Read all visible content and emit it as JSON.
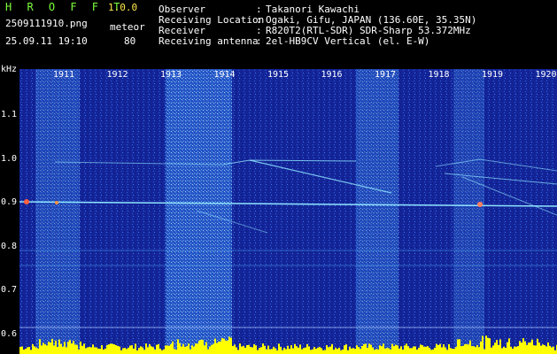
{
  "app": {
    "title": "H R O F F T",
    "version": "1.0.0",
    "filename": "2509111910.png",
    "meteor_label": "meteor",
    "datetime": "25.09.11 19:10",
    "meteor_count": "80"
  },
  "info": {
    "observer_label": "Observer",
    "observer_value": "Takanori Kawachi",
    "location_label": "Receiving Location",
    "location_value": "Ogaki, Gifu, JAPAN (136.60E, 35.35N)",
    "receiver_label": "Receiver",
    "receiver_value": "R820T2(RTL-SDR) SDR-Sharp 53.372MHz",
    "antenna_label": "Receiving antenna",
    "antenna_value": "2el-HB9CV Vertical (el. E-W)",
    "sep": ":"
  },
  "axes": {
    "unit": "kHz",
    "x_ticks": [
      "1911",
      "1912",
      "1913",
      "1914",
      "1915",
      "1916",
      "1917",
      "1918",
      "1919",
      "1920"
    ],
    "y_ticks": [
      "1.1",
      "1.0",
      "0.9",
      "0.8",
      "0.7",
      "0.6"
    ]
  },
  "colors": {
    "background": "#000000",
    "spectrogram_base": "#14259a",
    "signal": "#8fe6ff",
    "histogram": "#ffff00",
    "header_green": "#7cff3c"
  }
}
